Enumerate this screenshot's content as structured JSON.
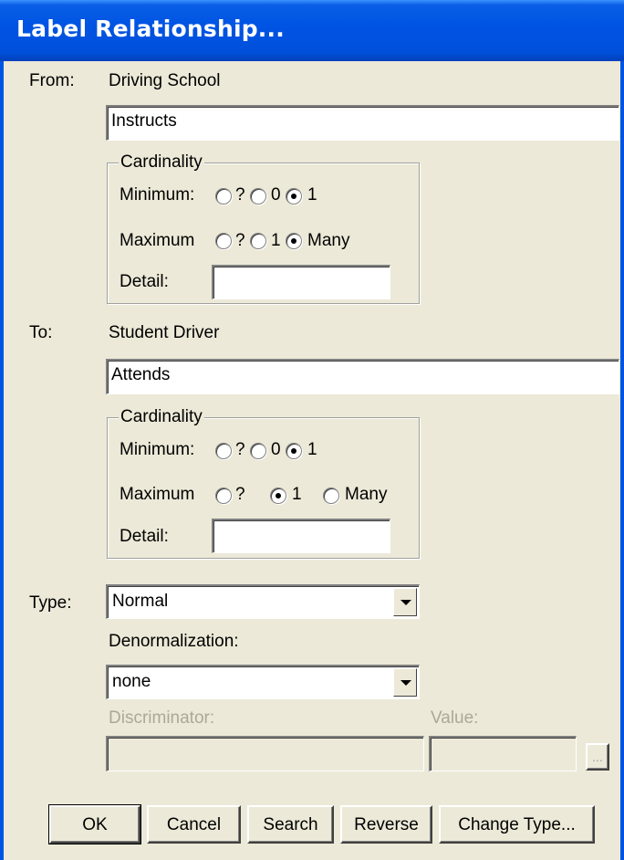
{
  "dialog": {
    "title": "Label Relationship..."
  },
  "from": {
    "label": "From:",
    "entity": "Driving School",
    "verb_phrase": "Instructs",
    "cardinality": {
      "legend": "Cardinality",
      "minimum_label": "Minimum:",
      "minimum_options": [
        "?",
        "0",
        "1"
      ],
      "minimum_selected": "1",
      "maximum_label": "Maximum",
      "maximum_options": [
        "?",
        "1",
        "Many"
      ],
      "maximum_selected": "Many",
      "detail_label": "Detail:",
      "detail_value": ""
    }
  },
  "to": {
    "label": "To:",
    "entity": "Student Driver",
    "verb_phrase": "Attends",
    "cardinality": {
      "legend": "Cardinality",
      "minimum_label": "Minimum:",
      "minimum_options": [
        "?",
        "0",
        "1"
      ],
      "minimum_selected": "1",
      "maximum_label": "Maximum",
      "maximum_options": [
        "?",
        "1",
        "Many"
      ],
      "maximum_selected": "1",
      "detail_label": "Detail:",
      "detail_value": ""
    }
  },
  "type": {
    "label": "Type:",
    "value": "Normal"
  },
  "denormalization": {
    "label": "Denormalization:",
    "value": "none"
  },
  "discriminator": {
    "label": "Discriminator:",
    "value": ""
  },
  "value_field": {
    "label": "Value:",
    "value": "",
    "browse_label": "..."
  },
  "buttons": {
    "ok": "OK",
    "cancel": "Cancel",
    "search": "Search",
    "reverse": "Reverse",
    "change_type": "Change Type..."
  },
  "colors": {
    "title_bar": "#0054e3",
    "dialog_bg": "#ece9d8",
    "disabled_text": "#aca899"
  }
}
